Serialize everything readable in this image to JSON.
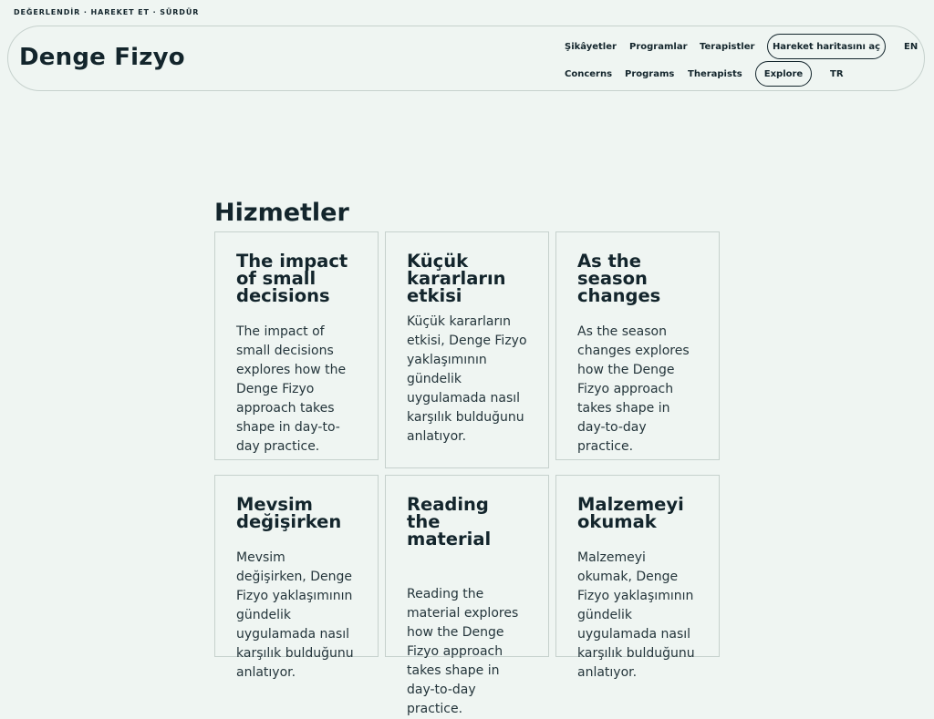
{
  "tagline": "DEĞERLENDİR · HAREKET ET · SÜRDÜR",
  "brand": "Denge Fizyo",
  "nav_tr": {
    "items": [
      "Şikâyetler",
      "Programlar",
      "Terapistler"
    ],
    "cta": "Hareket haritasını aç",
    "lang": "EN"
  },
  "nav_en": {
    "items": [
      "Concerns",
      "Programs",
      "Therapists"
    ],
    "cta": "Explore",
    "lang": "TR"
  },
  "section_title": "Hizmetler",
  "cards": [
    {
      "title": "The impact of small decisions",
      "body": "The impact of small decisions explores how the Denge Fizyo approach takes shape in day-to-day practice."
    },
    {
      "title": "Küçük kararların etkisi",
      "body": "Küçük kararların etkisi, Denge Fizyo yaklaşımının gündelik uygulamada nasıl karşılık bulduğunu anlatıyor."
    },
    {
      "title": "As the season changes",
      "body": "As the season changes explores how the Denge Fizyo approach takes shape in day-to-day practice."
    },
    {
      "title": "Mevsim değişirken",
      "body": "Mevsim değişirken, Denge Fizyo yaklaşımının gündelik uygulamada nasıl karşılık bulduğunu anlatıyor."
    },
    {
      "title": "Reading the material",
      "body": "Reading the material explores how the Denge Fizyo approach takes shape in day-to-day practice."
    },
    {
      "title": "Malzemeyi okumak",
      "body": "Malzemeyi okumak, Denge Fizyo yaklaşımının gündelik uygulamada nasıl karşılık bulduğunu anlatıyor."
    }
  ]
}
